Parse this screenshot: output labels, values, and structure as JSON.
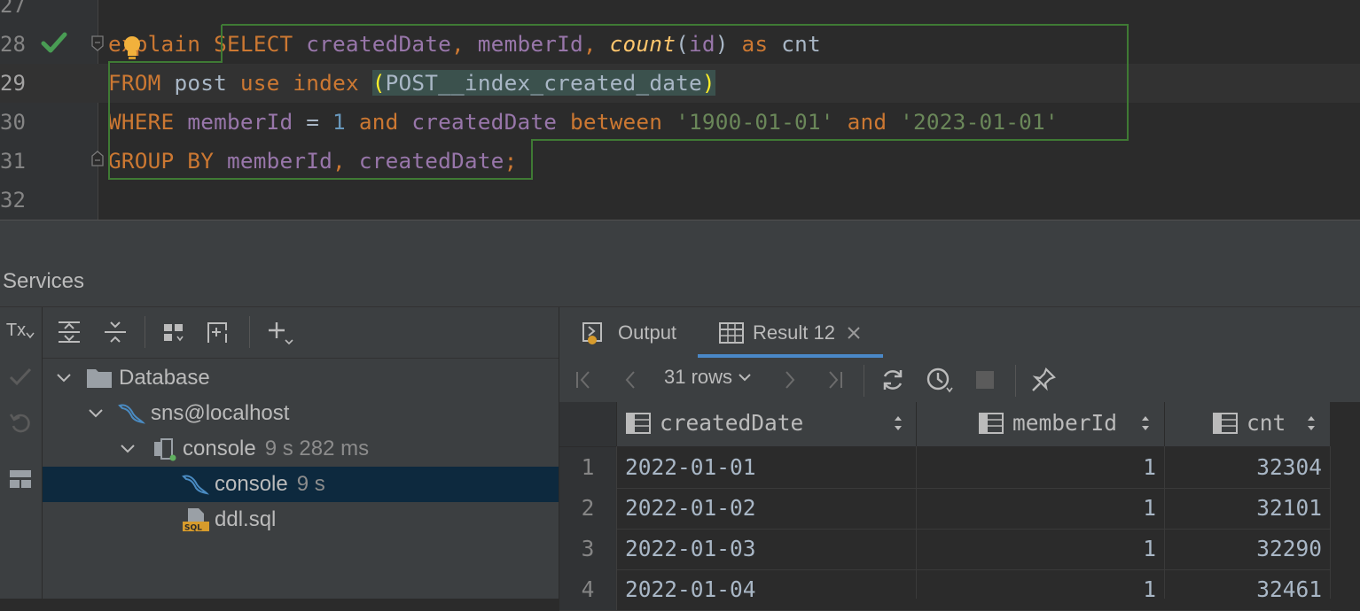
{
  "editor": {
    "line_numbers": [
      "27",
      "28",
      "29",
      "30",
      "31",
      "32"
    ],
    "line28": {
      "t1": "explain ",
      "t2": "SELECT ",
      "t3": "createdDate",
      "t4": ", ",
      "t5": "memberId",
      "t6": ", ",
      "t7": "count",
      "t8": "(",
      "t9": "id",
      "t10": ") ",
      "t11": "as ",
      "t12": "cnt"
    },
    "line29": {
      "t1": "FROM ",
      "t2": "post ",
      "t3": "use index ",
      "t4": "(",
      "t5": "POST__index_created_date",
      "t6": ")"
    },
    "line30": {
      "t1": "WHERE ",
      "t2": "memberId",
      "t3": " = ",
      "t4": "1",
      "t5": " and ",
      "t6": "createdDate",
      "t7": " between ",
      "t8": "'1900-01-01'",
      "t9": " and ",
      "t10": "'2023-01-01'"
    },
    "line31": {
      "t1": "GROUP BY ",
      "t2": "memberId",
      "t3": ", ",
      "t4": "createdDate",
      "t5": ";"
    }
  },
  "services": {
    "title": "Services",
    "left_strip": {
      "tx_label": "Tx"
    },
    "tree": [
      {
        "label": "Database",
        "meta": ""
      },
      {
        "label": "sns@localhost",
        "meta": ""
      },
      {
        "label": "console",
        "meta": "9 s 282 ms"
      },
      {
        "label": "console",
        "meta": "9 s"
      },
      {
        "label": "ddl.sql",
        "meta": ""
      }
    ]
  },
  "results": {
    "tabs": [
      {
        "label": "Output"
      },
      {
        "label": "Result 12"
      }
    ],
    "rows_label": "31 rows",
    "columns": [
      "createdDate",
      "memberId",
      "cnt"
    ],
    "rows": [
      {
        "n": "1",
        "createdDate": "2022-01-01",
        "memberId": "1",
        "cnt": "32304"
      },
      {
        "n": "2",
        "createdDate": "2022-01-02",
        "memberId": "1",
        "cnt": "32101"
      },
      {
        "n": "3",
        "createdDate": "2022-01-03",
        "memberId": "1",
        "cnt": "32290"
      },
      {
        "n": "4",
        "createdDate": "2022-01-04",
        "memberId": "1",
        "cnt": "32461"
      }
    ]
  },
  "colors": {
    "accent": "#4a88c7",
    "keyword": "#cc7832",
    "column": "#9876aa",
    "string": "#6a8759",
    "number": "#6897bb",
    "selected_row": "#0d293e"
  }
}
